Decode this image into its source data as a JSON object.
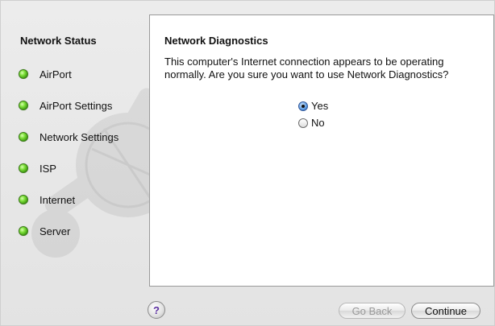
{
  "sidebar": {
    "title": "Network Status",
    "items": [
      {
        "label": "AirPort",
        "status_color": "#5cc21e"
      },
      {
        "label": "AirPort Settings",
        "status_color": "#5cc21e"
      },
      {
        "label": "Network Settings",
        "status_color": "#5cc21e"
      },
      {
        "label": "ISP",
        "status_color": "#5cc21e"
      },
      {
        "label": "Internet",
        "status_color": "#5cc21e"
      },
      {
        "label": "Server",
        "status_color": "#5cc21e"
      }
    ]
  },
  "main": {
    "title": "Network Diagnostics",
    "message": "This computer's Internet connection appears to be operating normally. Are you sure you want to use Network Diagnostics?",
    "options": [
      {
        "label": "Yes",
        "selected": true
      },
      {
        "label": "No",
        "selected": false
      }
    ]
  },
  "footer": {
    "help_label": "?",
    "back_label": "Go Back",
    "back_enabled": false,
    "continue_label": "Continue"
  },
  "icons": {
    "watermark": "network-diagnostics-wrench-icon",
    "status": "green-status-light-icon",
    "help": "help-icon"
  }
}
